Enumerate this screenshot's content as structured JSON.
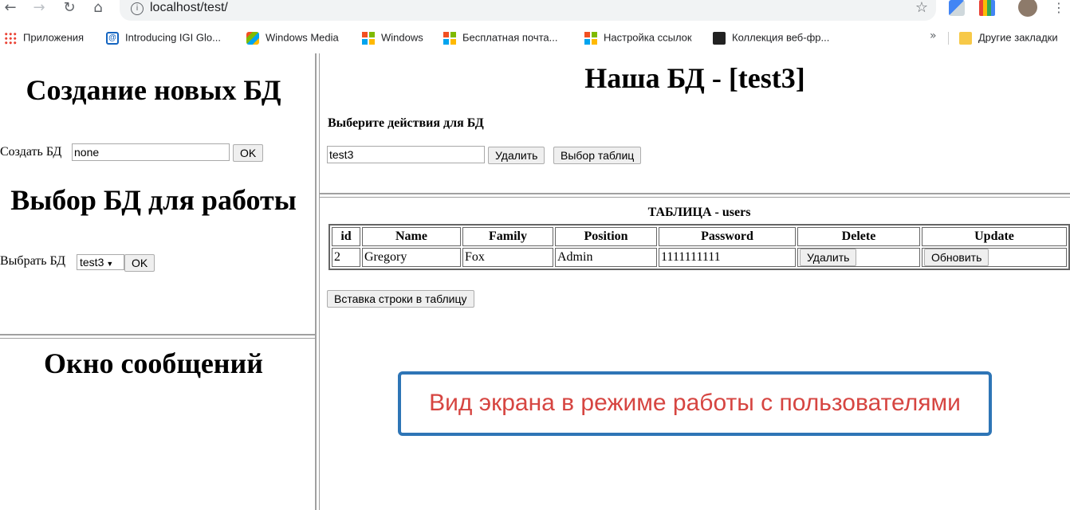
{
  "browser": {
    "url": "localhost/test/",
    "icons": [
      "back-icon",
      "forward-icon",
      "reload-icon",
      "home-icon",
      "info-icon",
      "star-icon"
    ],
    "bookmarks": [
      {
        "label": "Приложения",
        "icon": "apps-grid-icon"
      },
      {
        "label": "Introducing IGI Glo...",
        "icon": "igi-icon"
      },
      {
        "label": "Windows Media",
        "icon": "windows-media-icon"
      },
      {
        "label": "Windows",
        "icon": "windows-icon"
      },
      {
        "label": "Бесплатная почта...",
        "icon": "windows-icon"
      },
      {
        "label": "Настройка ссылок",
        "icon": "windows-icon"
      },
      {
        "label": "Коллекция веб-фр...",
        "icon": "collection-icon"
      }
    ],
    "overflow": "»",
    "other_bookmarks": "Другие закладки"
  },
  "left": {
    "create_title": "Создание новых БД",
    "create_label": "Создать БД",
    "create_value": "none",
    "create_ok": "OK",
    "select_title": "Выбор БД для работы",
    "select_label": "Выбрать БД",
    "select_value": "test3",
    "select_ok": "OK",
    "messages_title": "Окно сообщений"
  },
  "right": {
    "title": "Наша БД - [test3]",
    "actions_label": "Выберите действия для БД",
    "db_value": "test3",
    "delete_btn": "Удалить",
    "tables_btn": "Выбор таблиц",
    "table_caption": "ТАБЛИЦА - users",
    "columns": [
      "id",
      "Name",
      "Family",
      "Position",
      "Password",
      "Delete",
      "Update"
    ],
    "rows": [
      {
        "id": "2",
        "name": "Gregory",
        "family": "Fox",
        "position": "Admin",
        "password": "1111111111",
        "delete": "Удалить",
        "update": "Обновить"
      }
    ],
    "insert_btn": "Вставка строки в таблицу"
  },
  "callout": "Вид экрана в режиме работы с пользователями",
  "colors": {
    "callout_border": "#2e75b6",
    "callout_text": "#d64541"
  }
}
